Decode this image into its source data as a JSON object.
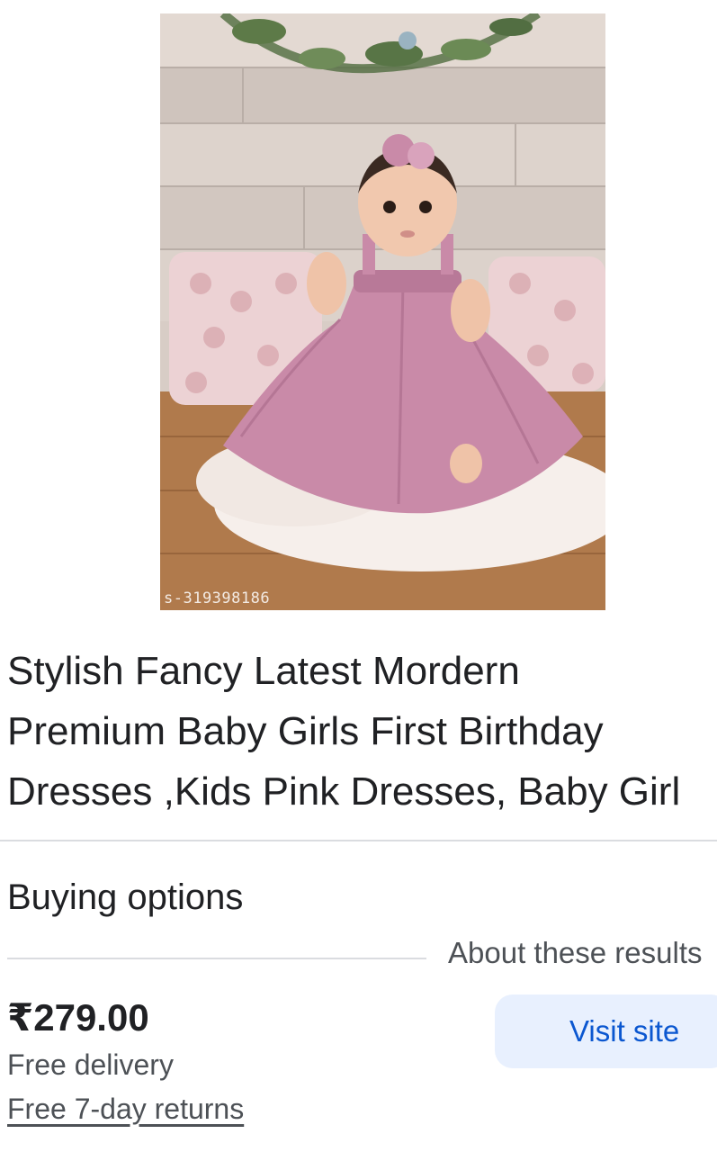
{
  "product": {
    "image_watermark": "s-319398186",
    "title_lines": [
      "Stylish Fancy Latest Mordern",
      "Premium Baby Girls First Birthday",
      "Dresses ,Kids Pink Dresses, Baby Girl"
    ]
  },
  "buying": {
    "heading": "Buying options",
    "about_link": "About these results",
    "price": "₹279.00",
    "delivery": "Free delivery",
    "returns": "Free 7-day returns",
    "visit_label": "Visit site"
  },
  "colors": {
    "accent": "#0b57d0",
    "button_bg": "#e8f0fe",
    "divider": "#dadce0",
    "dress": "#c98aa8"
  }
}
